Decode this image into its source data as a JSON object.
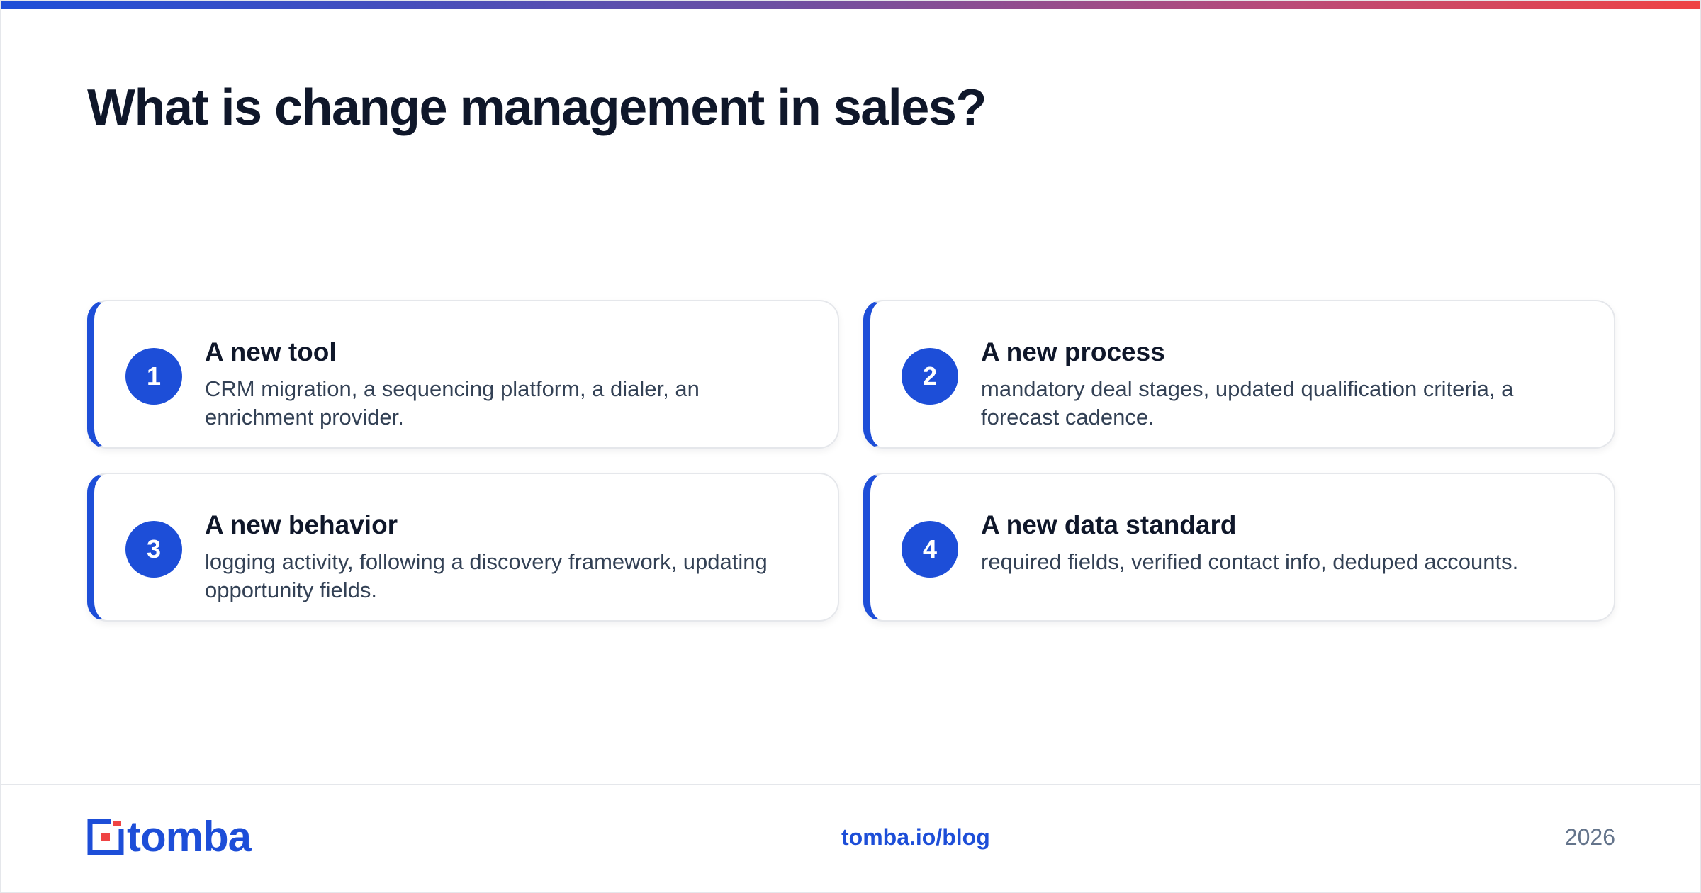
{
  "title": "What is change management in sales?",
  "cards": [
    {
      "number": "1",
      "title": "A new tool",
      "description": "CRM migration, a sequencing platform, a dialer, an enrichment provider."
    },
    {
      "number": "2",
      "title": "A new process",
      "description": "mandatory deal stages, updated qualification criteria, a forecast cadence."
    },
    {
      "number": "3",
      "title": "A new behavior",
      "description": "logging activity, following a discovery framework, updating opportunity fields."
    },
    {
      "number": "4",
      "title": "A new data standard",
      "description": "required fields, verified contact info, deduped accounts."
    }
  ],
  "footer": {
    "logo_text": "tomba",
    "link": "tomba.io/blog",
    "year": "2026"
  },
  "colors": {
    "accent": "#1d4ed8",
    "logo_red": "#ef4444",
    "gradient_start": "#1d4ed8",
    "gradient_end": "#ef4444",
    "title": "#0f172a",
    "body_text": "#334155",
    "muted": "#64748b"
  }
}
